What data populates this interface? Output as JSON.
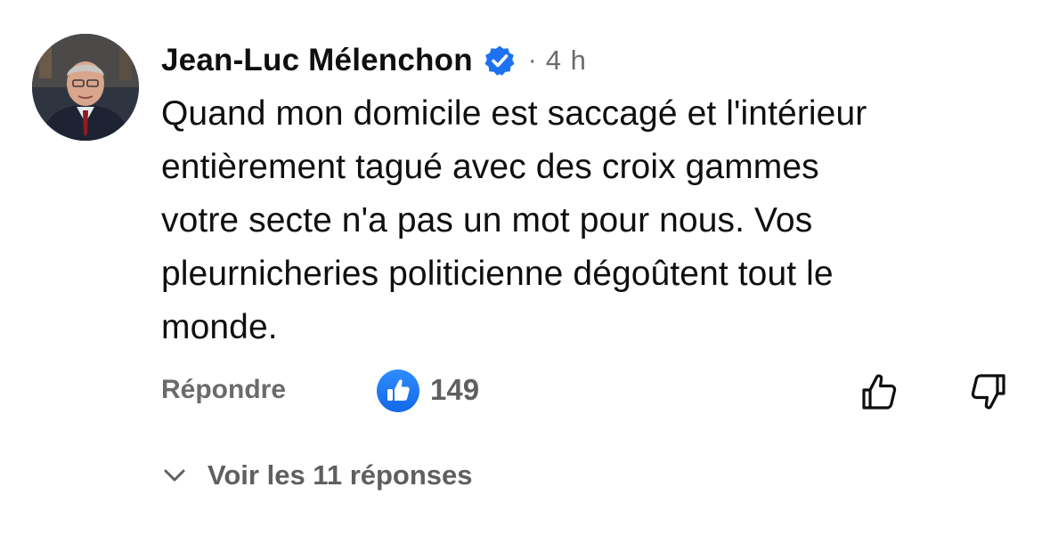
{
  "comment": {
    "author": "Jean-Luc Mélenchon",
    "separator": "·",
    "time": "4 h",
    "text": "Quand mon domicile est saccagé et l'intérieur\nentièrement tagué avec des croix gammes\nvotre secte n'a pas un mot pour nous. Vos\npleurnicheries politicienne dégoûtent tout le\nmonde."
  },
  "actions": {
    "reply_label": "Répondre",
    "like_count": "149"
  },
  "replies": {
    "label": "Voir les 11 réponses"
  },
  "icons": {
    "avatar": "user-avatar",
    "verified": "verified-badge-icon",
    "like_badge": "like-reaction-icon",
    "thumb_up": "thumb-up-icon",
    "thumb_down": "thumb-down-icon",
    "chevron": "chevron-down-icon"
  },
  "colors": {
    "accent": "#1d72f2",
    "text": "#0f0f0f",
    "muted": "#6b6b6b"
  }
}
